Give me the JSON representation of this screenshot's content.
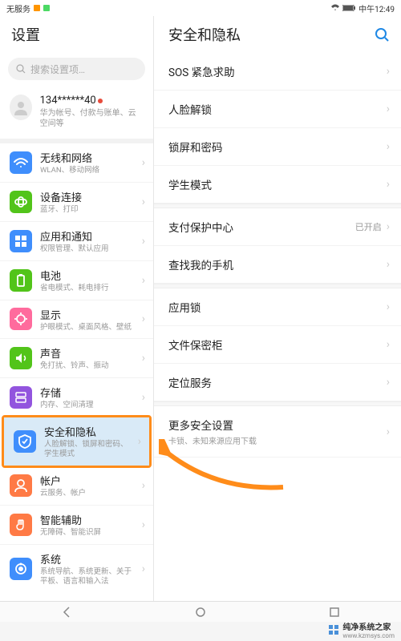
{
  "statusbar": {
    "left": "无服务",
    "time": "中午12:49"
  },
  "left": {
    "title": "设置",
    "search_placeholder": "搜索设置项…",
    "account": {
      "phone": "134******40",
      "sub": "华为帐号、付款与账单、云空间等"
    },
    "items": [
      {
        "title": "无线和网络",
        "sub": "WLAN、移动网络",
        "icon": "wifi",
        "color": "#3f8efc"
      },
      {
        "title": "设备连接",
        "sub": "蓝牙、打印",
        "icon": "link",
        "color": "#52c41a"
      },
      {
        "title": "应用和通知",
        "sub": "权限管理、默认应用",
        "icon": "grid",
        "color": "#3f8efc"
      },
      {
        "title": "电池",
        "sub": "省电模式、耗电排行",
        "icon": "battery",
        "color": "#52c41a"
      },
      {
        "title": "显示",
        "sub": "护眼模式、桌面风格、壁纸",
        "icon": "display",
        "color": "#ff6b9d"
      },
      {
        "title": "声音",
        "sub": "免打扰、铃声、振动",
        "icon": "sound",
        "color": "#52c41a"
      },
      {
        "title": "存储",
        "sub": "内存、空间清理",
        "icon": "storage",
        "color": "#9254de"
      },
      {
        "title": "安全和隐私",
        "sub": "人脸解锁、锁屏和密码、学生模式",
        "icon": "shield",
        "color": "#3f8efc",
        "highlight": true
      },
      {
        "title": "帐户",
        "sub": "云服务、帐户",
        "icon": "user",
        "color": "#ff7a45"
      },
      {
        "title": "智能辅助",
        "sub": "无障碍、智能识屏",
        "icon": "hand",
        "color": "#ff7a45"
      },
      {
        "title": "系统",
        "sub": "系统导航、系统更新、关于平板、语言和输入法",
        "icon": "system",
        "color": "#3f8efc"
      }
    ]
  },
  "right": {
    "title": "安全和隐私",
    "groups": [
      [
        {
          "title": "SOS 紧急求助"
        },
        {
          "title": "人脸解锁"
        },
        {
          "title": "锁屏和密码"
        },
        {
          "title": "学生模式"
        }
      ],
      [
        {
          "title": "支付保护中心",
          "value": "已开启"
        },
        {
          "title": "查找我的手机"
        }
      ],
      [
        {
          "title": "应用锁"
        },
        {
          "title": "文件保密柜"
        },
        {
          "title": "定位服务"
        }
      ],
      [
        {
          "title": "更多安全设置",
          "sub": "卡锁、未知来源应用下载"
        }
      ]
    ]
  },
  "watermark": {
    "site": "纯净系统之家",
    "url": "www.kzmsys.com"
  }
}
